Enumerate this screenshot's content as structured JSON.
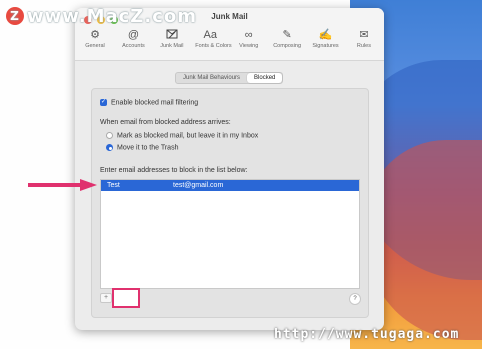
{
  "watermark": {
    "top": "www.MacZ.com",
    "bottom": "http://www.tugaga.com"
  },
  "window": {
    "title": "Junk Mail",
    "toolbar": [
      {
        "label": "General",
        "icon": "gear-icon",
        "glyph": "⚙"
      },
      {
        "label": "Accounts",
        "icon": "at-icon",
        "glyph": "@"
      },
      {
        "label": "Junk Mail",
        "icon": "junk-mail-icon",
        "glyph": "🗑"
      },
      {
        "label": "Fonts & Colors",
        "icon": "fonts-icon",
        "glyph": "Aa"
      },
      {
        "label": "Viewing",
        "icon": "glasses-icon",
        "glyph": "∞"
      },
      {
        "label": "Composing",
        "icon": "compose-icon",
        "glyph": "✎"
      },
      {
        "label": "Signatures",
        "icon": "signature-icon",
        "glyph": "✍"
      },
      {
        "label": "Rules",
        "icon": "rules-icon",
        "glyph": "✉"
      }
    ],
    "segments": [
      "Junk Mail Behaviours",
      "Blocked"
    ],
    "enable_blocked": "Enable blocked mail filtering",
    "when_label": "When email from blocked address arrives:",
    "option1": "Mark as blocked mail, but leave it in my Inbox",
    "option2": "Move it to the Trash",
    "list_label": "Enter email addresses to block in the list below:",
    "entries": [
      {
        "name": "Test",
        "email": "test@gmail.com"
      }
    ],
    "plus": "+",
    "help": "?"
  },
  "colors": {
    "accent": "#2a67d6",
    "highlight": "#e0316e"
  }
}
